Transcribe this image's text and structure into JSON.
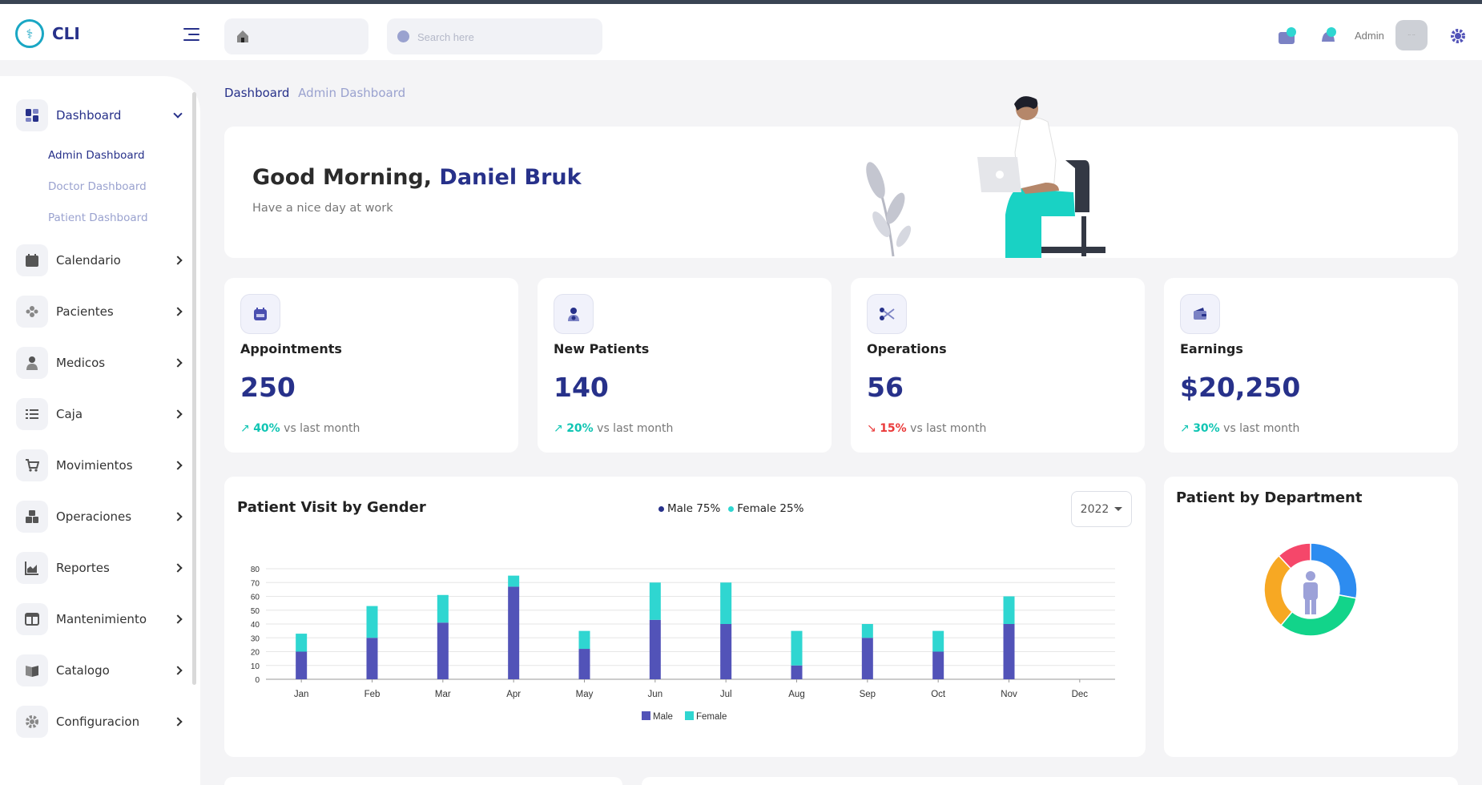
{
  "header": {
    "logo_text": "CLI",
    "search_placeholder": "Search here",
    "admin_label": "Admin",
    "avatar_text": "·· ··"
  },
  "sidebar": {
    "items": [
      {
        "label": "Dashboard",
        "icon": "dashboard-icon"
      },
      {
        "label": "Calendario",
        "icon": "calendar-icon"
      },
      {
        "label": "Pacientes",
        "icon": "patients-icon"
      },
      {
        "label": "Medicos",
        "icon": "doctor-icon"
      },
      {
        "label": "Caja",
        "icon": "checklist-icon"
      },
      {
        "label": "Movimientos",
        "icon": "cart-icon"
      },
      {
        "label": "Operaciones",
        "icon": "boxes-icon"
      },
      {
        "label": "Reportes",
        "icon": "report-chart-icon"
      },
      {
        "label": "Mantenimiento",
        "icon": "layout-icon"
      },
      {
        "label": "Catalogo",
        "icon": "book-icon"
      },
      {
        "label": "Configuracion",
        "icon": "gear-icon"
      }
    ],
    "sub_items": [
      "Admin Dashboard",
      "Doctor Dashboard",
      "Patient Dashboard"
    ]
  },
  "breadcrumb": {
    "first": "Dashboard",
    "second": "Admin Dashboard"
  },
  "welcome": {
    "greeting": "Good Morning,",
    "name": "Daniel Bruk",
    "subtitle": "Have a nice day at work"
  },
  "stats": [
    {
      "title": "Appointments",
      "value": "250",
      "trend_pct": "40%",
      "trend_dir": "up",
      "trend_suffix": " vs last month",
      "icon": "calendar-icon"
    },
    {
      "title": "New Patients",
      "value": "140",
      "trend_pct": "20%",
      "trend_dir": "up",
      "trend_suffix": " vs last month",
      "icon": "patient-add-icon"
    },
    {
      "title": "Operations",
      "value": "56",
      "trend_pct": "15%",
      "trend_dir": "down",
      "trend_suffix": " vs last month",
      "icon": "scissors-icon"
    },
    {
      "title": "Earnings",
      "value": "$20,250",
      "trend_pct": "30%",
      "trend_dir": "up",
      "trend_suffix": " vs last month",
      "icon": "wallet-icon"
    }
  ],
  "gender_chart": {
    "title": "Patient Visit by Gender",
    "legend_male": "Male 75%",
    "legend_female": "Female 25%",
    "year": "2022"
  },
  "department_chart": {
    "title": "Patient by Department"
  },
  "colors": {
    "primary": "#27318a",
    "male": "#5253b8",
    "female": "#2fd6d1",
    "trend_up": "#10c5b3",
    "trend_down": "#ea3a3a"
  },
  "chart_data": [
    {
      "type": "bar",
      "stacked": true,
      "categories": [
        "Jan",
        "Feb",
        "Mar",
        "Apr",
        "May",
        "Jun",
        "Jul",
        "Aug",
        "Sep",
        "Oct",
        "Nov",
        "Dec"
      ],
      "series": [
        {
          "name": "Male",
          "color": "#5253b8",
          "values": [
            20,
            30,
            41,
            67,
            22,
            43,
            40,
            10,
            30,
            20,
            40,
            0
          ]
        },
        {
          "name": "Female",
          "color": "#2fd6d1",
          "values": [
            13,
            23,
            20,
            8,
            13,
            27,
            30,
            25,
            10,
            15,
            20,
            0
          ]
        }
      ],
      "yticks": [
        0,
        10,
        20,
        30,
        40,
        50,
        60,
        70,
        80
      ],
      "ylim": [
        0,
        80
      ],
      "grid": true,
      "legend_position": "bottom"
    },
    {
      "type": "pie",
      "donut": true,
      "slices": [
        {
          "value": 28,
          "color": "#2d8cf0"
        },
        {
          "value": 33,
          "color": "#12d48a"
        },
        {
          "value": 27,
          "color": "#f7a823"
        },
        {
          "value": 12,
          "color": "#f5476a"
        }
      ]
    }
  ]
}
